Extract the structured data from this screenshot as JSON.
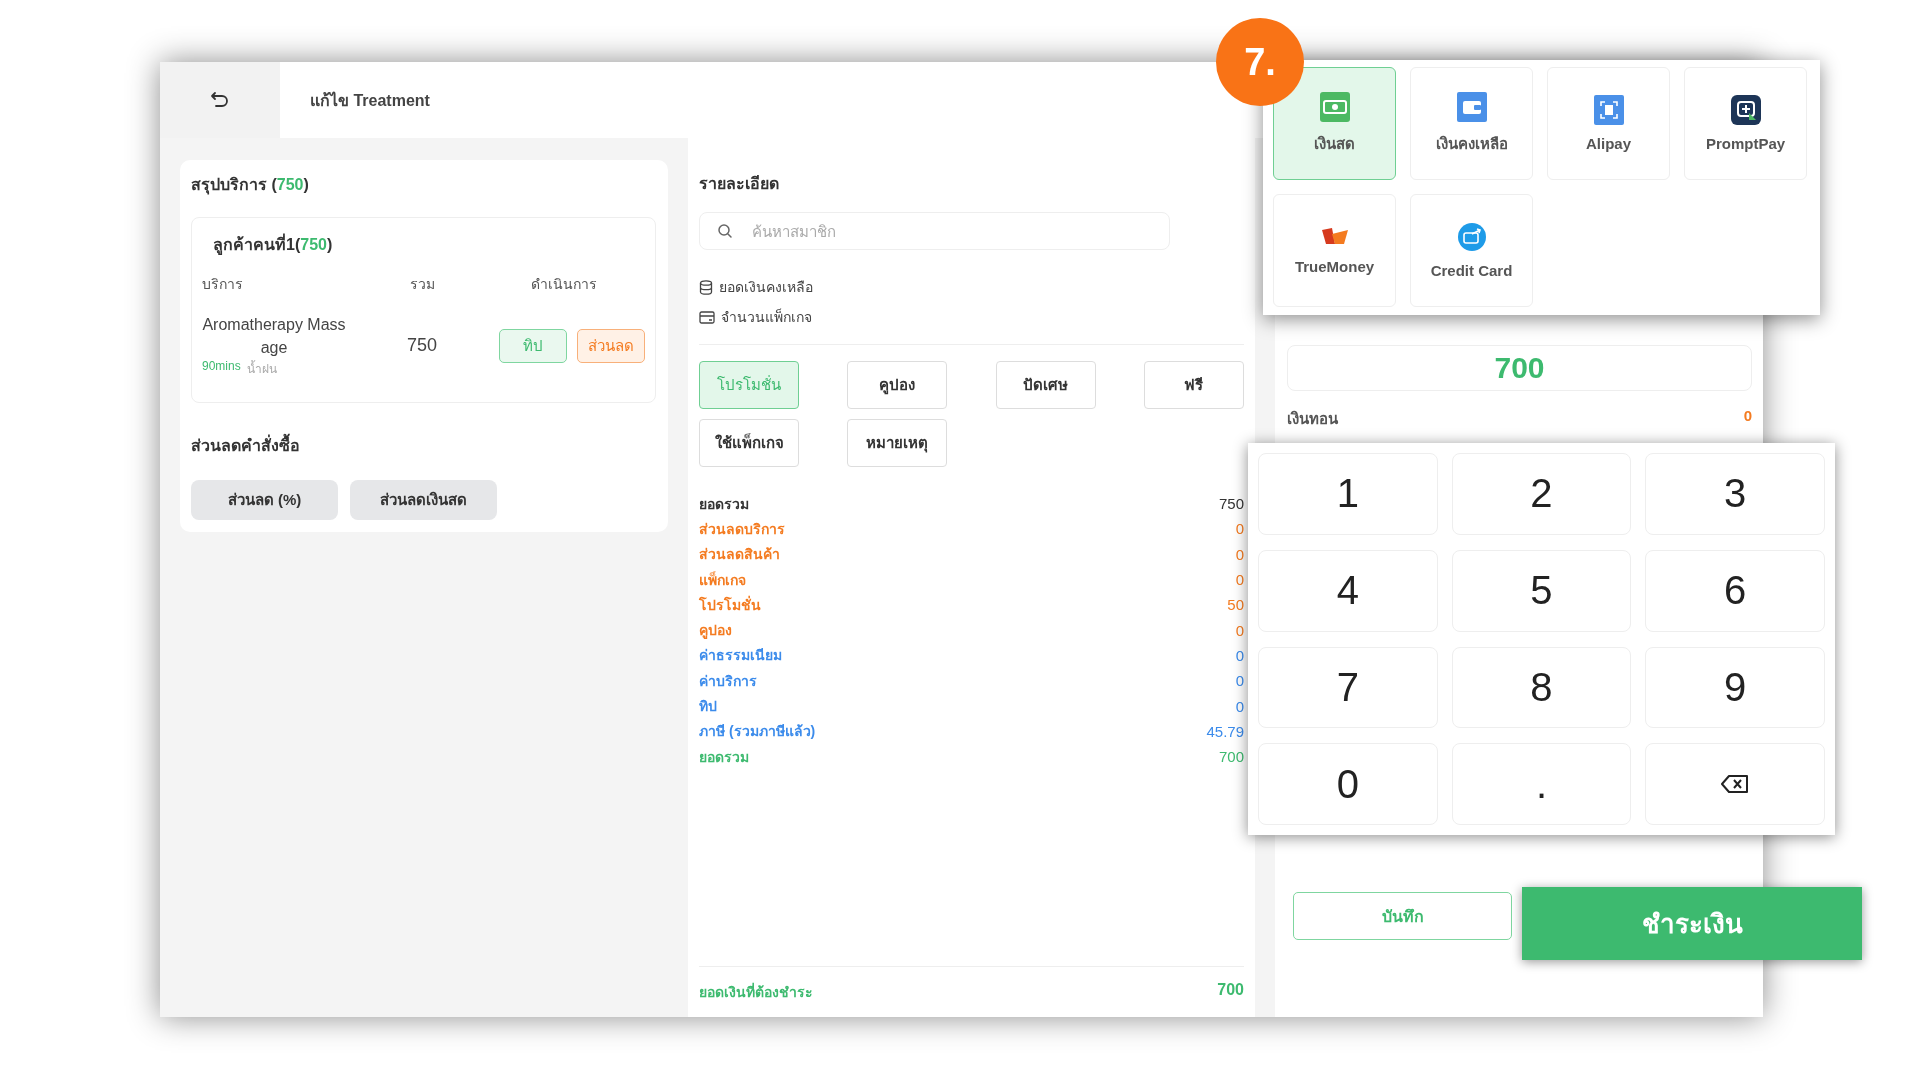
{
  "header": {
    "title": "แก้ไข Treatment"
  },
  "service_summary": {
    "title": "สรุปบริการ (",
    "total": "750",
    "title_end": ")",
    "customer": {
      "label": "ลูกค้าคนที่1(",
      "total": "750",
      "label_end": ")"
    },
    "columns": [
      "บริการ",
      "รวม",
      "ดำเนินการ"
    ],
    "items": [
      {
        "name": "Aromatherapy Massage",
        "duration": "90mins",
        "staff": "น้ำฝน",
        "total": "750",
        "actions": [
          "ทิป",
          "ส่วนลด"
        ]
      }
    ]
  },
  "order_discount": {
    "title": "ส่วนลดคำสั่งซื้อ",
    "buttons": [
      "ส่วนลด (%)",
      "ส่วนลดเงินสด"
    ]
  },
  "details": {
    "title": "รายละเอียด",
    "search": {
      "placeholder": "ค้นหาสมาชิก"
    },
    "balance_label": "ยอดเงินคงเหลือ",
    "package_label": "จำนวนแพ็กเกจ",
    "options": [
      {
        "label": "โปรโมชั่น",
        "selected": true
      },
      {
        "label": "คูปอง",
        "selected": false
      },
      {
        "label": "ปัดเศษ",
        "selected": false
      },
      {
        "label": "ฟรี",
        "selected": false
      },
      {
        "label": "ใช้แพ็กเกจ",
        "selected": false
      },
      {
        "label": "หมายเหตุ",
        "selected": false
      }
    ],
    "summary": [
      {
        "label": "ยอดรวม",
        "value": "750",
        "color": "#333333"
      },
      {
        "label": "ส่วนลดบริการ",
        "value": "0",
        "color": "#f47b20"
      },
      {
        "label": "ส่วนลดสินค้า",
        "value": "0",
        "color": "#f47b20"
      },
      {
        "label": "แพ็กเกจ",
        "value": "0",
        "color": "#f47b20"
      },
      {
        "label": "โปรโมชั่น",
        "value": "50",
        "color": "#f47b20"
      },
      {
        "label": "คูปอง",
        "value": "0",
        "color": "#f47b20"
      },
      {
        "label": "ค่าธรรมเนียม",
        "value": "0",
        "color": "#3b8beb"
      },
      {
        "label": "ค่าบริการ",
        "value": "0",
        "color": "#3b8beb"
      },
      {
        "label": "ทิป",
        "value": "0",
        "color": "#3b8beb"
      },
      {
        "label": "ภาษี (รวมภาษีแล้ว)",
        "value": "45.79",
        "color": "#3b8beb"
      },
      {
        "label": "ยอดรวม",
        "value": "700",
        "color": "#3dba6f"
      }
    ],
    "amount_due": {
      "label": "ยอดเงินที่ต้องชำระ",
      "value": "700"
    }
  },
  "step_badge": "7.",
  "payment_methods": [
    {
      "label": "เงินสด",
      "kind": "cash",
      "selected": true
    },
    {
      "label": "เงินคงเหลือ",
      "kind": "wallet",
      "selected": false
    },
    {
      "label": "Alipay",
      "kind": "alipay",
      "selected": false
    },
    {
      "label": "PromptPay",
      "kind": "promptpay",
      "selected": false
    },
    {
      "label": "TrueMoney",
      "kind": "truemoney",
      "selected": false
    },
    {
      "label": "Credit Card",
      "kind": "card",
      "selected": false
    }
  ],
  "amount": "700",
  "change": {
    "label": "เงินทอน",
    "value": "0"
  },
  "keypad": [
    {
      "kind": "key",
      "label": "1"
    },
    {
      "kind": "key",
      "label": "2"
    },
    {
      "kind": "key",
      "label": "3"
    },
    {
      "kind": "key",
      "label": "4"
    },
    {
      "kind": "key",
      "label": "5"
    },
    {
      "kind": "key",
      "label": "6"
    },
    {
      "kind": "key",
      "label": "7"
    },
    {
      "kind": "key",
      "label": "8"
    },
    {
      "kind": "key",
      "label": "9"
    },
    {
      "kind": "key",
      "label": "0"
    },
    {
      "kind": "key",
      "label": "."
    },
    {
      "kind": "backspace"
    }
  ],
  "save_button": "บันทึก",
  "pay_button": "ชำระเงิน"
}
